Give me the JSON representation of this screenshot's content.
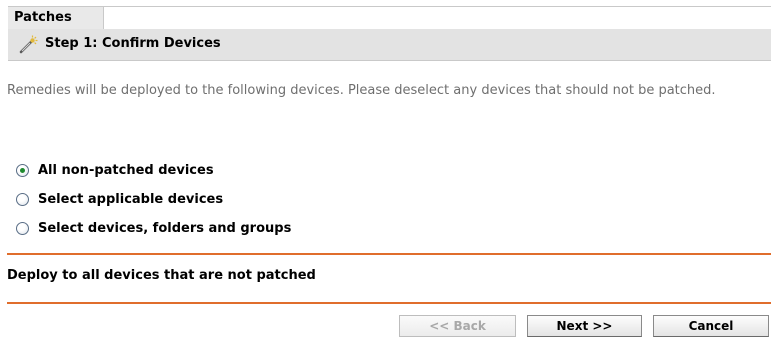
{
  "tab": {
    "label": "Patches"
  },
  "step": {
    "title": "Step 1: Confirm Devices",
    "icon": "wizard-wand-icon"
  },
  "description": "Remedies will be deployed to the following devices. Please deselect any devices that should not be patched.",
  "options": [
    {
      "label": "All non-patched devices",
      "selected": true
    },
    {
      "label": "Select applicable devices",
      "selected": false
    },
    {
      "label": "Select devices, folders and groups",
      "selected": false
    }
  ],
  "summary": "Deploy to all devices that are not patched",
  "buttons": {
    "back": "<< Back",
    "next": "Next >>",
    "cancel": "Cancel"
  },
  "colors": {
    "accent_rule": "#e06d2c",
    "step_bar": "#e3e3e3",
    "selected_radio": "#1f8a2f"
  }
}
